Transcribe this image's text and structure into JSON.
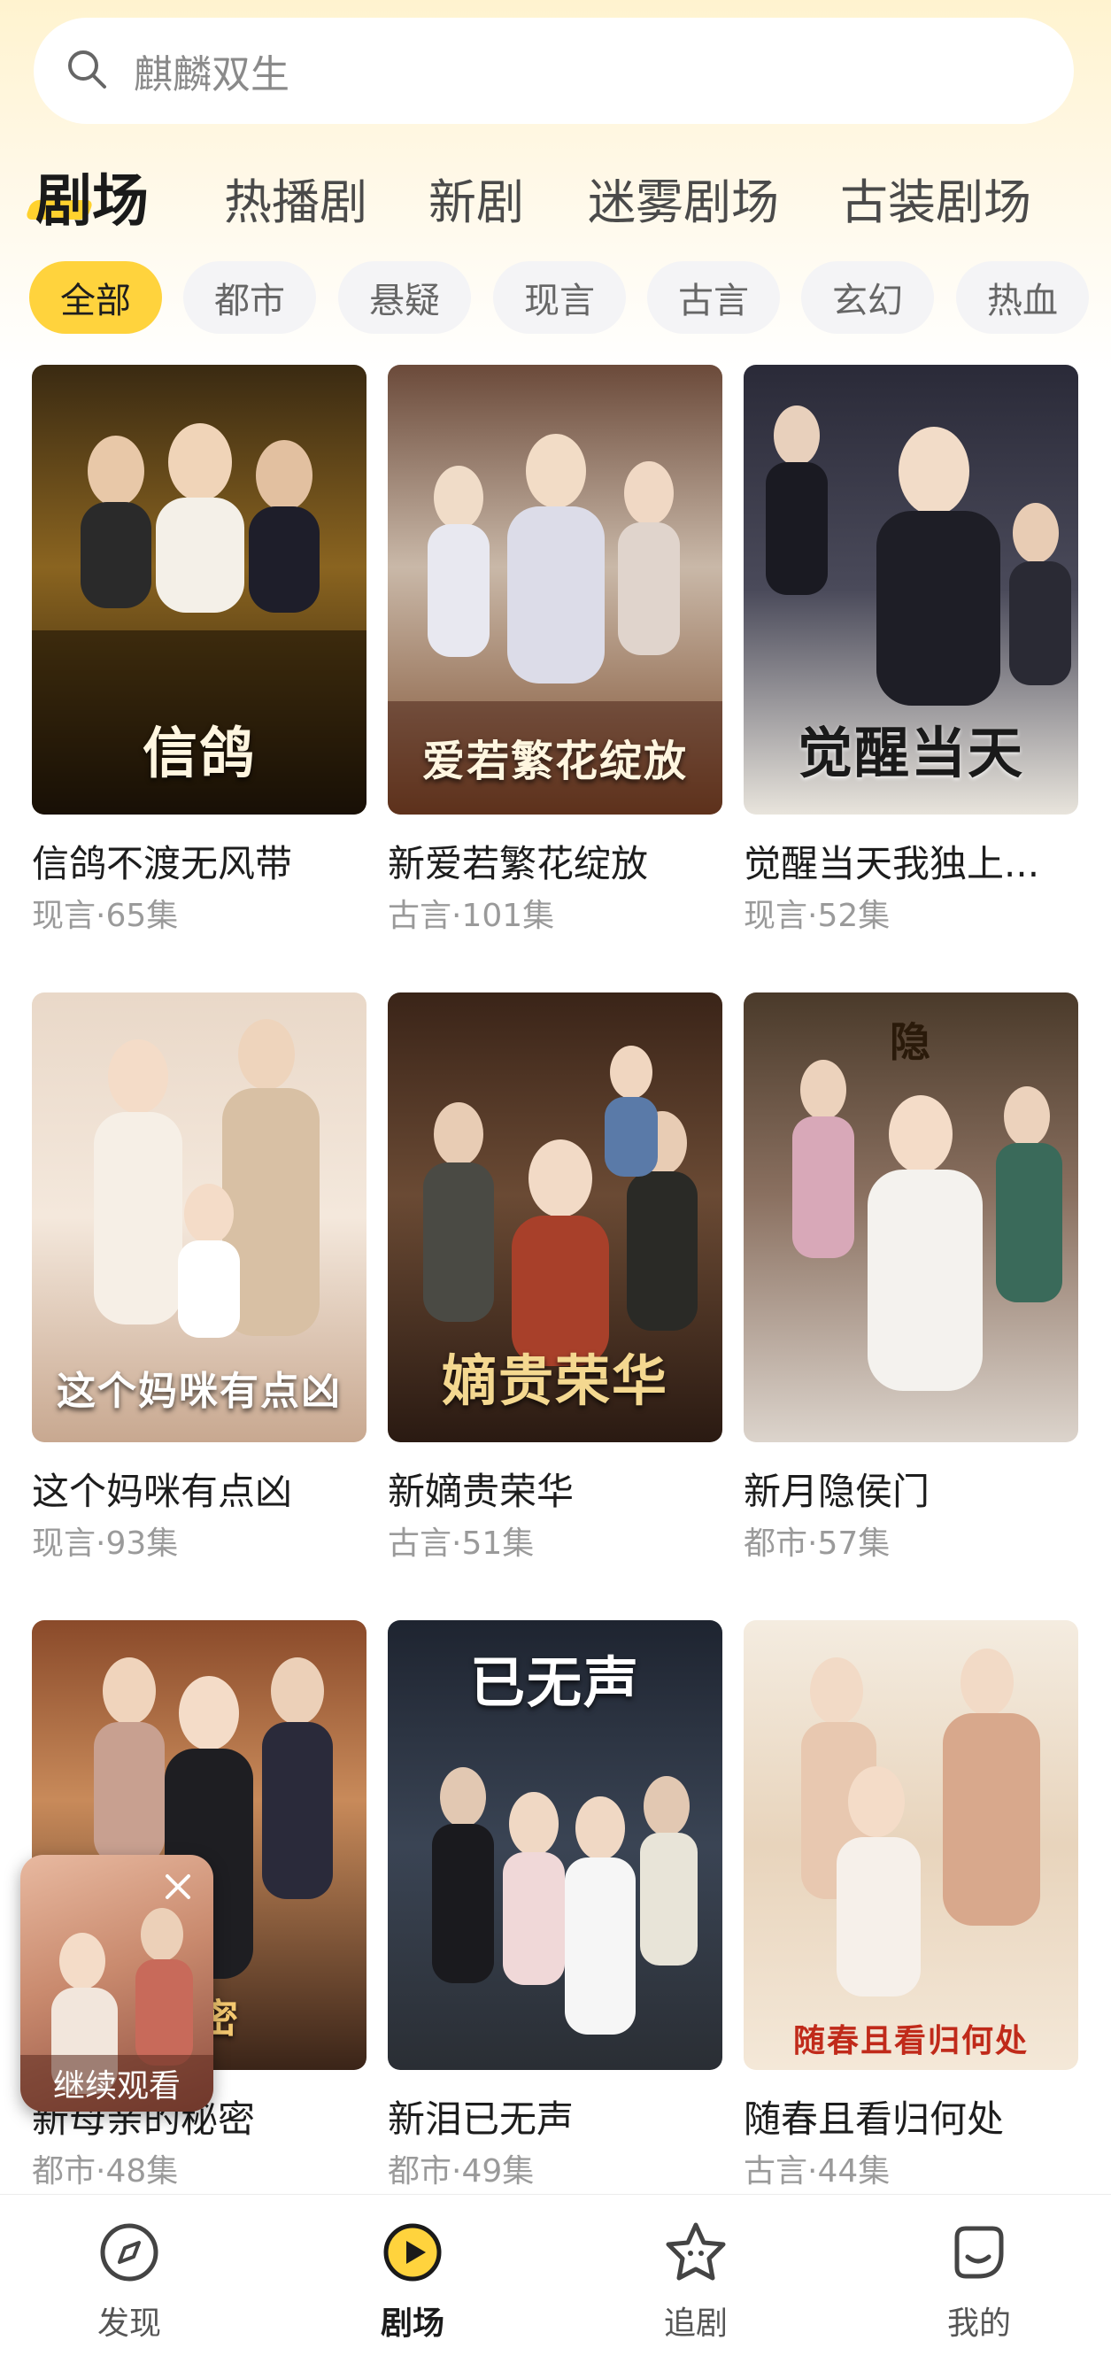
{
  "search": {
    "placeholder": "麒麟双生",
    "icon": "search-icon"
  },
  "tabs": [
    {
      "label": "剧场",
      "active": true
    },
    {
      "label": "热播剧"
    },
    {
      "label": "新剧"
    },
    {
      "label": "迷雾剧场"
    },
    {
      "label": "古装剧场"
    }
  ],
  "chips": [
    {
      "label": "全部",
      "active": true
    },
    {
      "label": "都市"
    },
    {
      "label": "悬疑"
    },
    {
      "label": "现言"
    },
    {
      "label": "古言"
    },
    {
      "label": "玄幻"
    },
    {
      "label": "热血"
    }
  ],
  "dramas": [
    {
      "title": "信鸽不渡无风带",
      "meta": "现言·65集",
      "poster_text": "信鸽"
    },
    {
      "title": "新爱若繁花绽放",
      "meta": "古言·101集",
      "poster_text": "爱若繁花绽放"
    },
    {
      "title": "觉醒当天我独上...",
      "meta": "现言·52集",
      "poster_text": "觉醒当天"
    },
    {
      "title": "这个妈咪有点凶",
      "meta": "现言·93集",
      "poster_text": "这个妈咪有点凶"
    },
    {
      "title": "新嫡贵荣华",
      "meta": "古言·51集",
      "poster_text": "嫡贵荣华"
    },
    {
      "title": "新月隐侯门",
      "meta": "都市·57集",
      "poster_text": "隐"
    },
    {
      "title": "新母亲的秘密",
      "meta": "都市·48集",
      "poster_text": "秘密"
    },
    {
      "title": "新泪已无声",
      "meta": "都市·49集",
      "poster_text": "已无声"
    },
    {
      "title": "随春且看归何处",
      "meta": "古言·44集",
      "poster_text": "随春且看归何处"
    }
  ],
  "floating_player": {
    "label": "继续观看",
    "close_icon": "close-icon"
  },
  "bottom_nav": [
    {
      "label": "发现",
      "icon": "compass-icon"
    },
    {
      "label": "剧场",
      "icon": "play-icon",
      "active": true
    },
    {
      "label": "追剧",
      "icon": "star-house-icon"
    },
    {
      "label": "我的",
      "icon": "profile-icon"
    }
  ],
  "colors": {
    "accent": "#ffd33d",
    "chip_bg": "#f4f4f6",
    "text_primary": "#1d1d1d",
    "text_secondary": "#9a9a9a"
  }
}
